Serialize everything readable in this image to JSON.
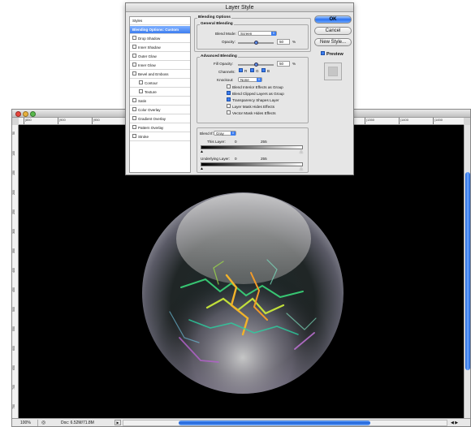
{
  "dialog": {
    "title": "Layer Style",
    "styles": [
      {
        "label": "Styles",
        "checkbox": false,
        "selected": false,
        "indent": false
      },
      {
        "label": "Blending Options: Custom",
        "checkbox": false,
        "selected": true,
        "indent": false
      },
      {
        "label": "Drop Shadow",
        "checkbox": true,
        "selected": false,
        "indent": false
      },
      {
        "label": "Inner Shadow",
        "checkbox": true,
        "selected": false,
        "indent": false
      },
      {
        "label": "Outer Glow",
        "checkbox": true,
        "selected": false,
        "indent": false
      },
      {
        "label": "Inner Glow",
        "checkbox": true,
        "selected": false,
        "indent": false
      },
      {
        "label": "Bevel and Emboss",
        "checkbox": true,
        "selected": false,
        "indent": false
      },
      {
        "label": "Contour",
        "checkbox": true,
        "selected": false,
        "indent": true
      },
      {
        "label": "Texture",
        "checkbox": true,
        "selected": false,
        "indent": true
      },
      {
        "label": "Satin",
        "checkbox": true,
        "selected": false,
        "indent": false
      },
      {
        "label": "Color Overlay",
        "checkbox": true,
        "selected": false,
        "indent": false
      },
      {
        "label": "Gradient Overlay",
        "checkbox": true,
        "selected": false,
        "indent": false
      },
      {
        "label": "Pattern Overlay",
        "checkbox": true,
        "selected": false,
        "indent": false
      },
      {
        "label": "Stroke",
        "checkbox": true,
        "selected": false,
        "indent": false
      }
    ],
    "blending_options_title": "Blending Options",
    "general": {
      "title": "General Blending",
      "blend_mode_label": "Blend Mode:",
      "blend_mode_value": "Screen",
      "opacity_label": "Opacity:",
      "opacity_value": "50",
      "opacity_unit": "%",
      "opacity_level": 0.5
    },
    "advanced": {
      "title": "Advanced Blending",
      "fill_opacity_label": "Fill Opacity:",
      "fill_opacity_value": "50",
      "fill_opacity_unit": "%",
      "fill_opacity_level": 0.5,
      "channels_label": "Channels:",
      "channels": [
        {
          "label": "R",
          "checked": true
        },
        {
          "label": "G",
          "checked": true
        },
        {
          "label": "B",
          "checked": true
        }
      ],
      "knockout_label": "Knockout:",
      "knockout_value": "None",
      "options": [
        {
          "label": "Blend Interior Effects as Group",
          "checked": false
        },
        {
          "label": "Blend Clipped Layers as Group",
          "checked": true
        },
        {
          "label": "Transparency Shapes Layer",
          "checked": true
        },
        {
          "label": "Layer Mask Hides Effects",
          "checked": false
        },
        {
          "label": "Vector Mask Hides Effects",
          "checked": false
        }
      ]
    },
    "blend_if": {
      "label": "Blend If:",
      "value": "Gray",
      "this_layer_label": "This Layer:",
      "this_layer_min": "0",
      "this_layer_max": "255",
      "underlying_label": "Underlying Layer:",
      "underlying_min": "0",
      "underlying_max": "255"
    },
    "buttons": {
      "ok": "OK",
      "cancel": "Cancel",
      "new_style": "New Style..."
    },
    "preview_label": "Preview",
    "preview_checked": true
  },
  "document": {
    "ruler_top_labels": [
      "|850",
      "|900",
      "|950",
      "|1000",
      "|1050",
      "|1100",
      "|1150",
      "|1200",
      "|1250",
      "|1300",
      "|1350",
      "|1400",
      "|1450"
    ],
    "ruler_left_labels": [
      "50",
      "100",
      "150",
      "200",
      "250",
      "300",
      "350",
      "400",
      "450",
      "500",
      "550",
      "600",
      "650",
      "700",
      "750"
    ],
    "zoom": "100%",
    "doc_size": "Doc: 6.52M/71.8M",
    "scroll_arrows": "◀ ▶",
    "status_arrow": "▶"
  },
  "colors": {
    "accent": "#3d7ef0",
    "canvas": "#000000",
    "selection": "#5a90f0"
  }
}
